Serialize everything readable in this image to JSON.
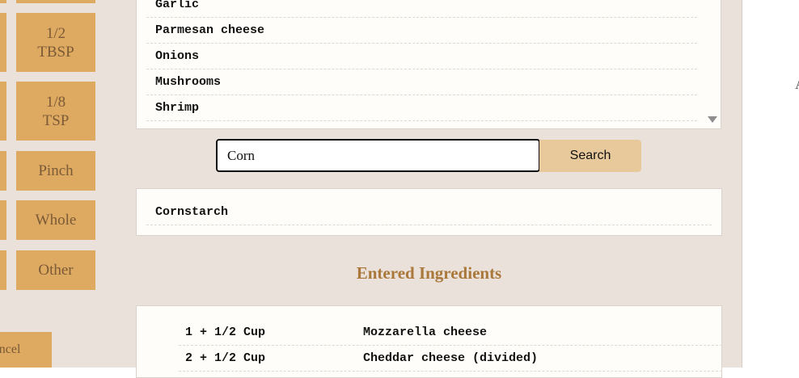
{
  "units": [
    {
      "label": "1/2\nTBSP"
    },
    {
      "label": "1/8\nTSP"
    },
    {
      "label": "Pinch"
    },
    {
      "label": "Whole"
    },
    {
      "label": "Other"
    }
  ],
  "cancel_label": "Cancel",
  "ingredient_list": [
    "Garlic",
    "Parmesan cheese",
    "Onions",
    "Mushrooms",
    "Shrimp"
  ],
  "search": {
    "value": "Corn",
    "button_label": "Search"
  },
  "results": [
    "Cornstarch"
  ],
  "entered": {
    "title": "Entered Ingredients",
    "rows": [
      {
        "qty": "1 + 1/2 Cup",
        "name": "Mozzarella cheese"
      },
      {
        "qty": "2 + 1/2 Cup",
        "name": "Cheddar cheese (divided)"
      }
    ]
  },
  "edge_text": "A",
  "colors": {
    "background": "#ebe1db",
    "unit_button": "#deaa62",
    "search_button": "#e8c99b",
    "title": "#a9783a"
  }
}
